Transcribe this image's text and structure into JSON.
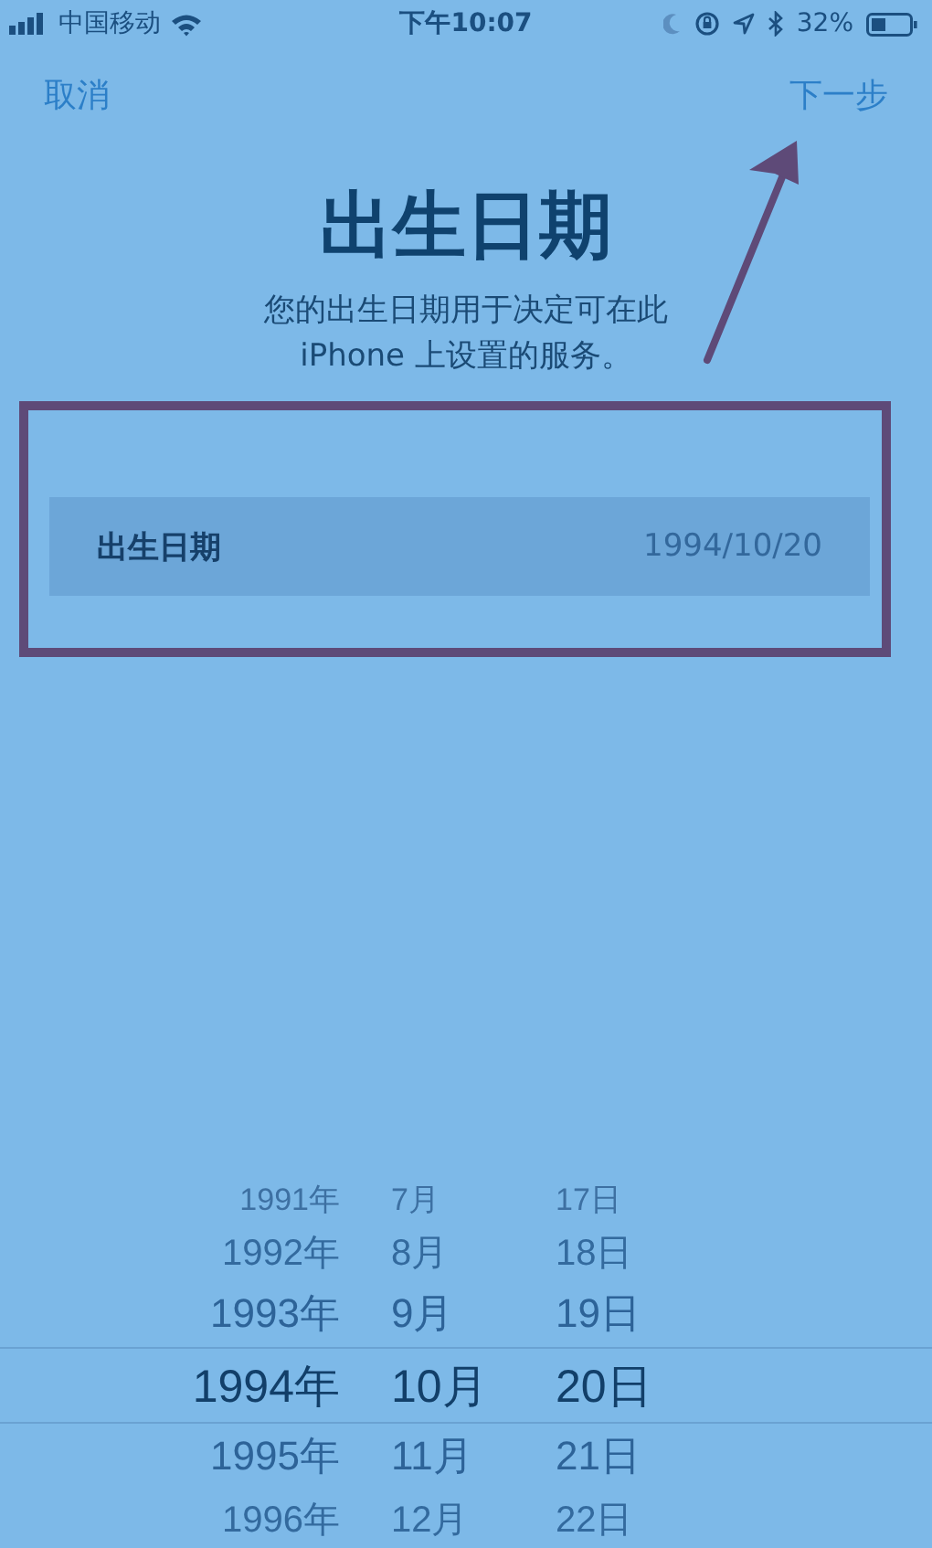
{
  "status_bar": {
    "carrier": "中国移动",
    "time": "下午10:07",
    "battery_text": "32%"
  },
  "nav": {
    "cancel": "取消",
    "next": "下一步"
  },
  "title": "出生日期",
  "subtitle_lines": [
    "您的出生日期用于决定可在此",
    "iPhone 上设置的服务。"
  ],
  "field": {
    "label": "出生日期",
    "value": "1994/10/20"
  },
  "picker_rows": [
    {
      "year": "1991年",
      "month": "7月",
      "day": "17日",
      "selected": false
    },
    {
      "year": "1992年",
      "month": "8月",
      "day": "18日",
      "selected": false
    },
    {
      "year": "1993年",
      "month": "9月",
      "day": "19日",
      "selected": false
    },
    {
      "year": "1994年",
      "month": "10月",
      "day": "20日",
      "selected": true
    },
    {
      "year": "1995年",
      "month": "11月",
      "day": "21日",
      "selected": false
    },
    {
      "year": "1996年",
      "month": "12月",
      "day": "22日",
      "selected": false
    }
  ],
  "annotations": {
    "arrow": {
      "color": "#5e4a78"
    },
    "frame": {
      "color": "#5e4a78"
    }
  }
}
